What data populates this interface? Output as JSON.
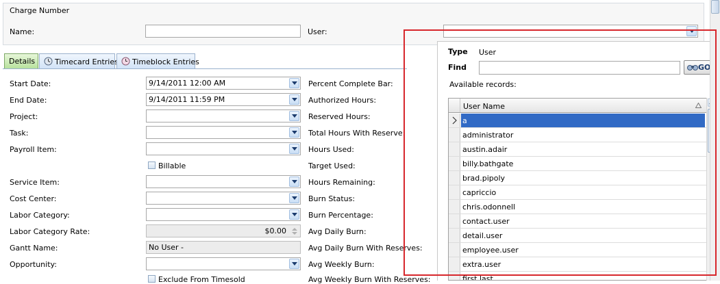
{
  "header": {
    "group_title": "Charge Number",
    "name_label": "Name:",
    "name_value": "",
    "user_label": "User:",
    "user_value": ""
  },
  "tabs": [
    {
      "label": "Details",
      "active": true
    },
    {
      "label": "Timecard Entries",
      "active": false
    },
    {
      "label": "Timeblock Entries",
      "active": false
    }
  ],
  "left_fields": {
    "start_date": {
      "label": "Start Date:",
      "value": "9/14/2011 12:00 AM"
    },
    "end_date": {
      "label": "End Date:",
      "value": "9/14/2011 11:59 PM"
    },
    "project": {
      "label": "Project:",
      "value": ""
    },
    "task": {
      "label": "Task:",
      "value": ""
    },
    "payroll_item": {
      "label": "Payroll Item:",
      "value": ""
    },
    "billable": {
      "label": "Billable",
      "checked": false
    },
    "service_item": {
      "label": "Service Item:",
      "value": ""
    },
    "cost_center": {
      "label": "Cost Center:",
      "value": ""
    },
    "labor_category": {
      "label": "Labor Category:",
      "value": ""
    },
    "labor_category_rate": {
      "label": "Labor Category Rate:",
      "value": "$0.00"
    },
    "gantt_name": {
      "label": "Gantt Name:",
      "value": "No User -"
    },
    "opportunity": {
      "label": "Opportunity:",
      "value": ""
    },
    "exclude_from_timesold": {
      "label": "Exclude From Timesold",
      "checked": false
    }
  },
  "right_labels": [
    "Percent Complete Bar:",
    "Authorized Hours:",
    "Reserved Hours:",
    "Total Hours With Reserve:",
    "Hours Used:",
    "Target Used:",
    "Hours Remaining:",
    "Burn Status:",
    "Burn Percentage:",
    "Avg Daily Burn:",
    "Avg Daily Burn With Reserves:",
    "Avg Weekly Burn:",
    "Avg Weekly Burn With Reserves:"
  ],
  "popup": {
    "type_label": "Type",
    "type_value": "User",
    "find_label": "Find",
    "find_value": "",
    "go_label": "GO!",
    "available_label": "Available records:",
    "column_header": "User Name",
    "records": [
      "a",
      "administrator",
      "austin.adair",
      "billy.bathgate",
      "brad.pipoly",
      "capriccio",
      "chris.odonnell",
      "contact.user",
      "detail.user",
      "employee.user",
      "extra.user",
      "first.last"
    ],
    "selected_index": 0
  },
  "colors": {
    "highlight_border": "#d7262b",
    "selected_row": "#316ac5",
    "active_tab": "#b7e19d"
  }
}
